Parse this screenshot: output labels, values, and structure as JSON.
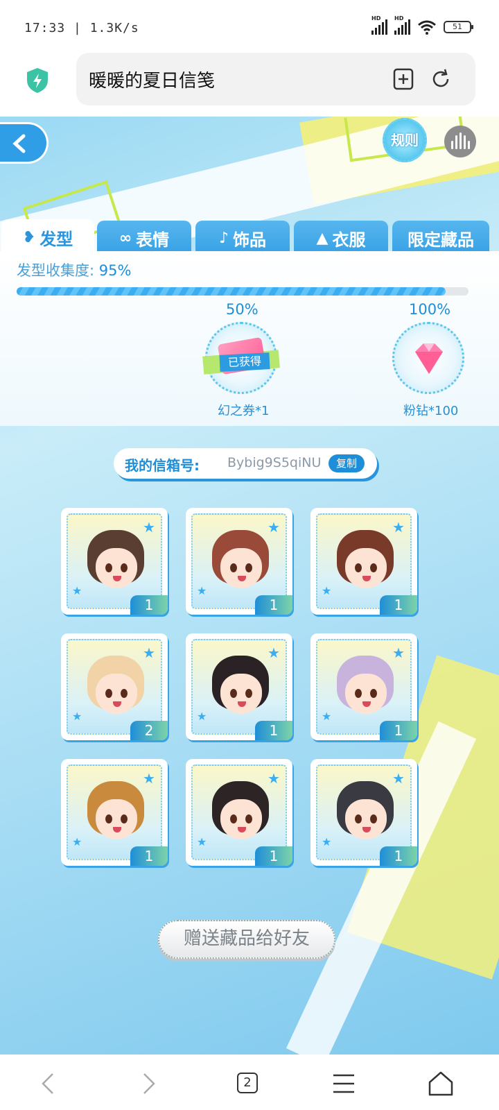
{
  "status_bar": {
    "time_speed": "17:33 | 1.3K/s",
    "battery": "51",
    "hd1": "HD",
    "hd2": "HD"
  },
  "browser": {
    "page_title": "暖暖的夏日信笺",
    "tab_count": "2"
  },
  "header": {
    "rule_label": "规则"
  },
  "tabs": [
    {
      "label": "发型",
      "icon": "hair-icon",
      "active": true
    },
    {
      "label": "表情",
      "icon": "mask-icon",
      "active": false
    },
    {
      "label": "饰品",
      "icon": "accessory-icon",
      "active": false
    },
    {
      "label": "衣服",
      "icon": "clothes-icon",
      "active": false
    },
    {
      "label": "限定藏品",
      "icon": "",
      "active": false
    }
  ],
  "collection": {
    "label": "发型收集度:",
    "percent_text": "95%",
    "progress": 0.95,
    "milestones": [
      {
        "pct": "50%",
        "reward": "幻之券*1",
        "status": "已获得"
      },
      {
        "pct": "100%",
        "reward": "粉钻*100"
      }
    ]
  },
  "mailbox": {
    "label": "我的信箱号:",
    "id": "Bybig9S5qiNU",
    "copy_label": "复制"
  },
  "items": [
    {
      "count": "1",
      "hair_color": "#5a3e32"
    },
    {
      "count": "1",
      "hair_color": "#9a4a38"
    },
    {
      "count": "1",
      "hair_color": "#7a3a2a"
    },
    {
      "count": "2",
      "hair_color": "#f2d3a8"
    },
    {
      "count": "1",
      "hair_color": "#2a2224"
    },
    {
      "count": "1",
      "hair_color": "#c7b3dc"
    },
    {
      "count": "1",
      "hair_color": "#c98a3e"
    },
    {
      "count": "1",
      "hair_color": "#2d2426"
    },
    {
      "count": "1",
      "hair_color": "#3a3a42"
    }
  ],
  "gift_button": "赠送藏品给好友",
  "colors": {
    "accent": "#1f8ed8",
    "tab_blue": "#3aa3e6",
    "background": "#a8dcf4"
  }
}
